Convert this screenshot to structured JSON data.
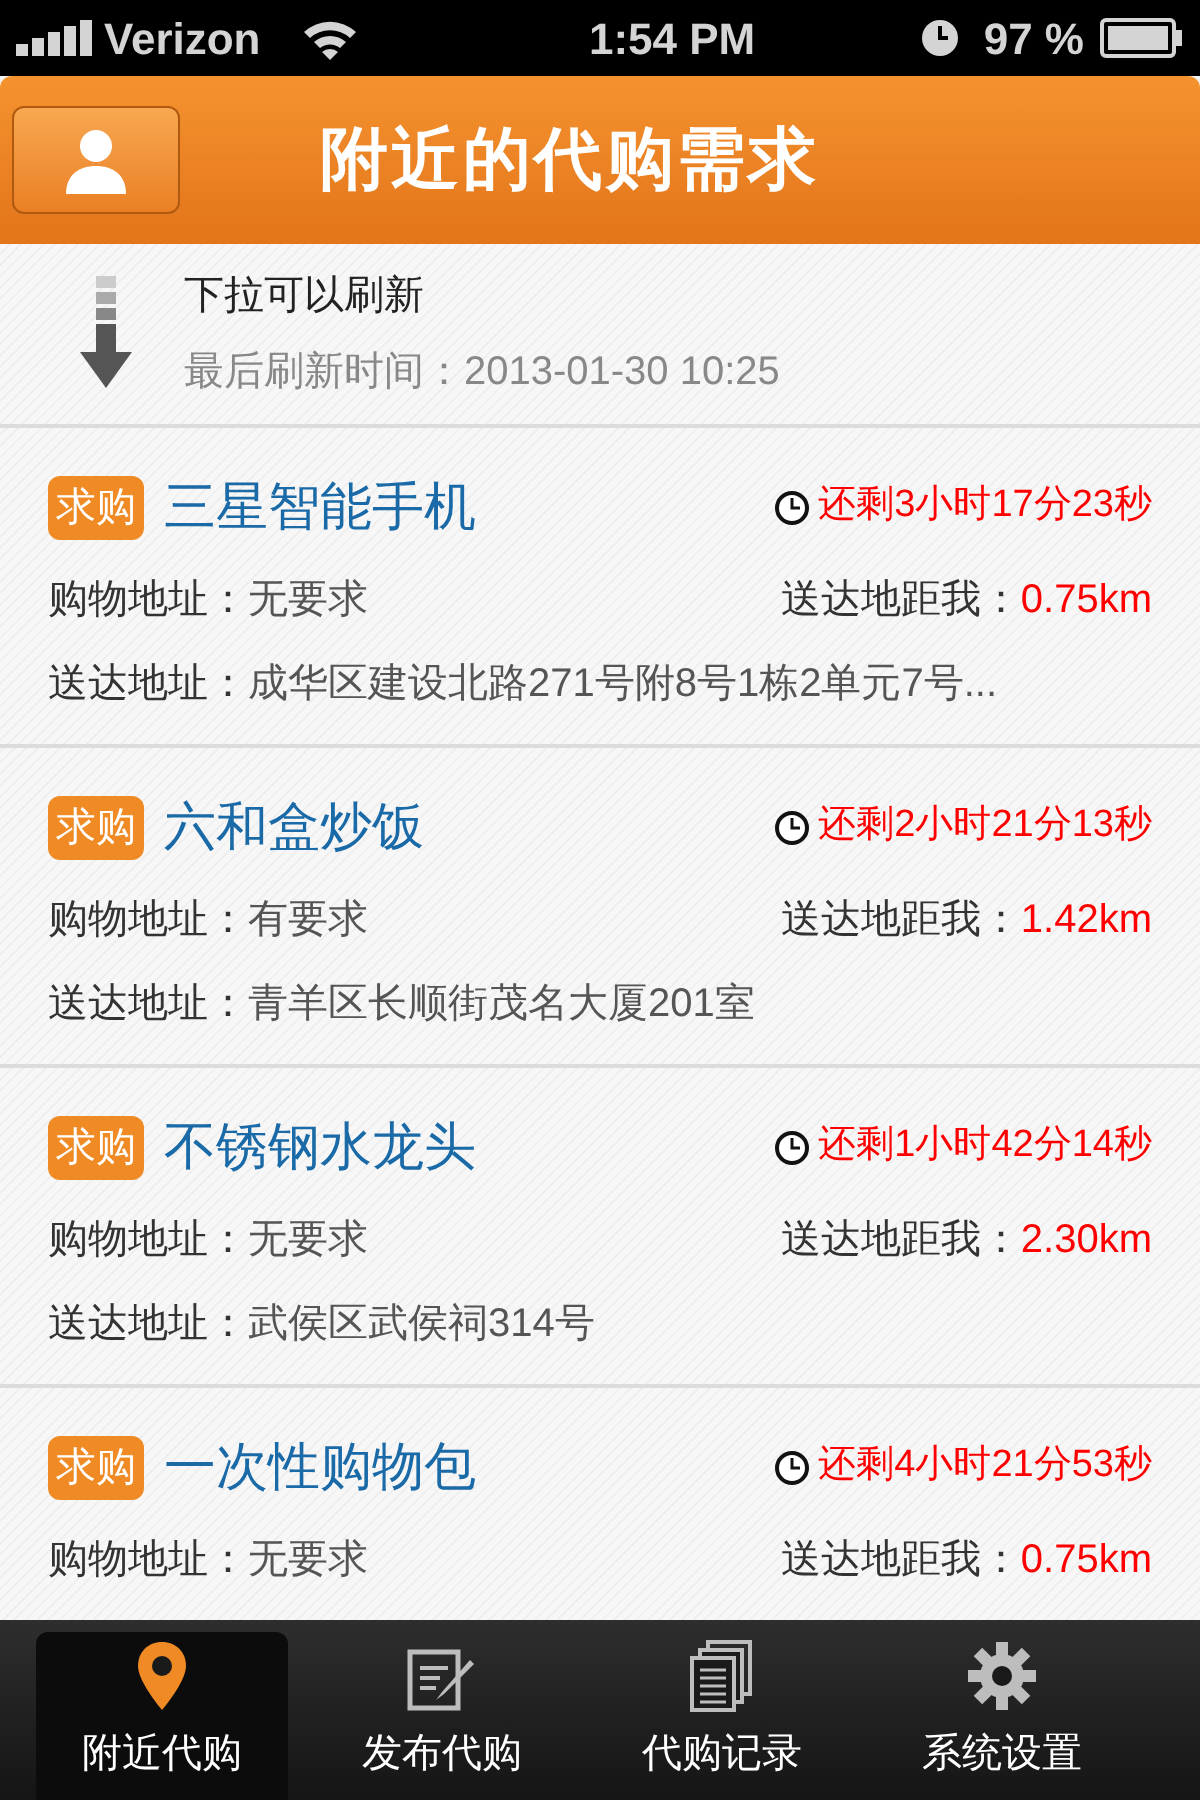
{
  "status_bar": {
    "carrier": "Verizon",
    "time": "1:54 PM",
    "battery": "97 %"
  },
  "header": {
    "title": "附近的代购需求"
  },
  "refresh": {
    "hint": "下拉可以刷新",
    "last_updated": "最后刷新时间：2013-01-30 10:25"
  },
  "requests": [
    {
      "tag": "求购",
      "title": "三星智能手机",
      "remaining": "还剩3小时17分23秒",
      "shop_label": "购物地址：",
      "shop_value": "无要求",
      "distance_label": "送达地距我：",
      "distance": "0.75km",
      "address_label": "送达地址：",
      "address": "成华区建设北路271号附8号1栋2单元7号..."
    },
    {
      "tag": "求购",
      "title": "六和盒炒饭",
      "remaining": "还剩2小时21分13秒",
      "shop_label": "购物地址：",
      "shop_value": "有要求",
      "distance_label": "送达地距我：",
      "distance": "1.42km",
      "address_label": "送达地址：",
      "address": "青羊区长顺街茂名大厦201室"
    },
    {
      "tag": "求购",
      "title": "不锈钢水龙头",
      "remaining": "还剩1小时42分14秒",
      "shop_label": "购物地址：",
      "shop_value": "无要求",
      "distance_label": "送达地距我：",
      "distance": "2.30km",
      "address_label": "送达地址：",
      "address": "武侯区武侯祠314号"
    },
    {
      "tag": "求购",
      "title": "一次性购物包",
      "remaining": "还剩4小时21分53秒",
      "shop_label": "购物地址：",
      "shop_value": "无要求",
      "distance_label": "送达地距我：",
      "distance": "0.75km"
    }
  ],
  "tab_bar": [
    {
      "label": "附近代购",
      "kind": "pin",
      "selected": true
    },
    {
      "label": "发布代购",
      "kind": "notepad",
      "selected": false
    },
    {
      "label": "代购记录",
      "kind": "documents",
      "selected": false
    },
    {
      "label": "系统设置",
      "kind": "gear",
      "selected": false
    }
  ]
}
